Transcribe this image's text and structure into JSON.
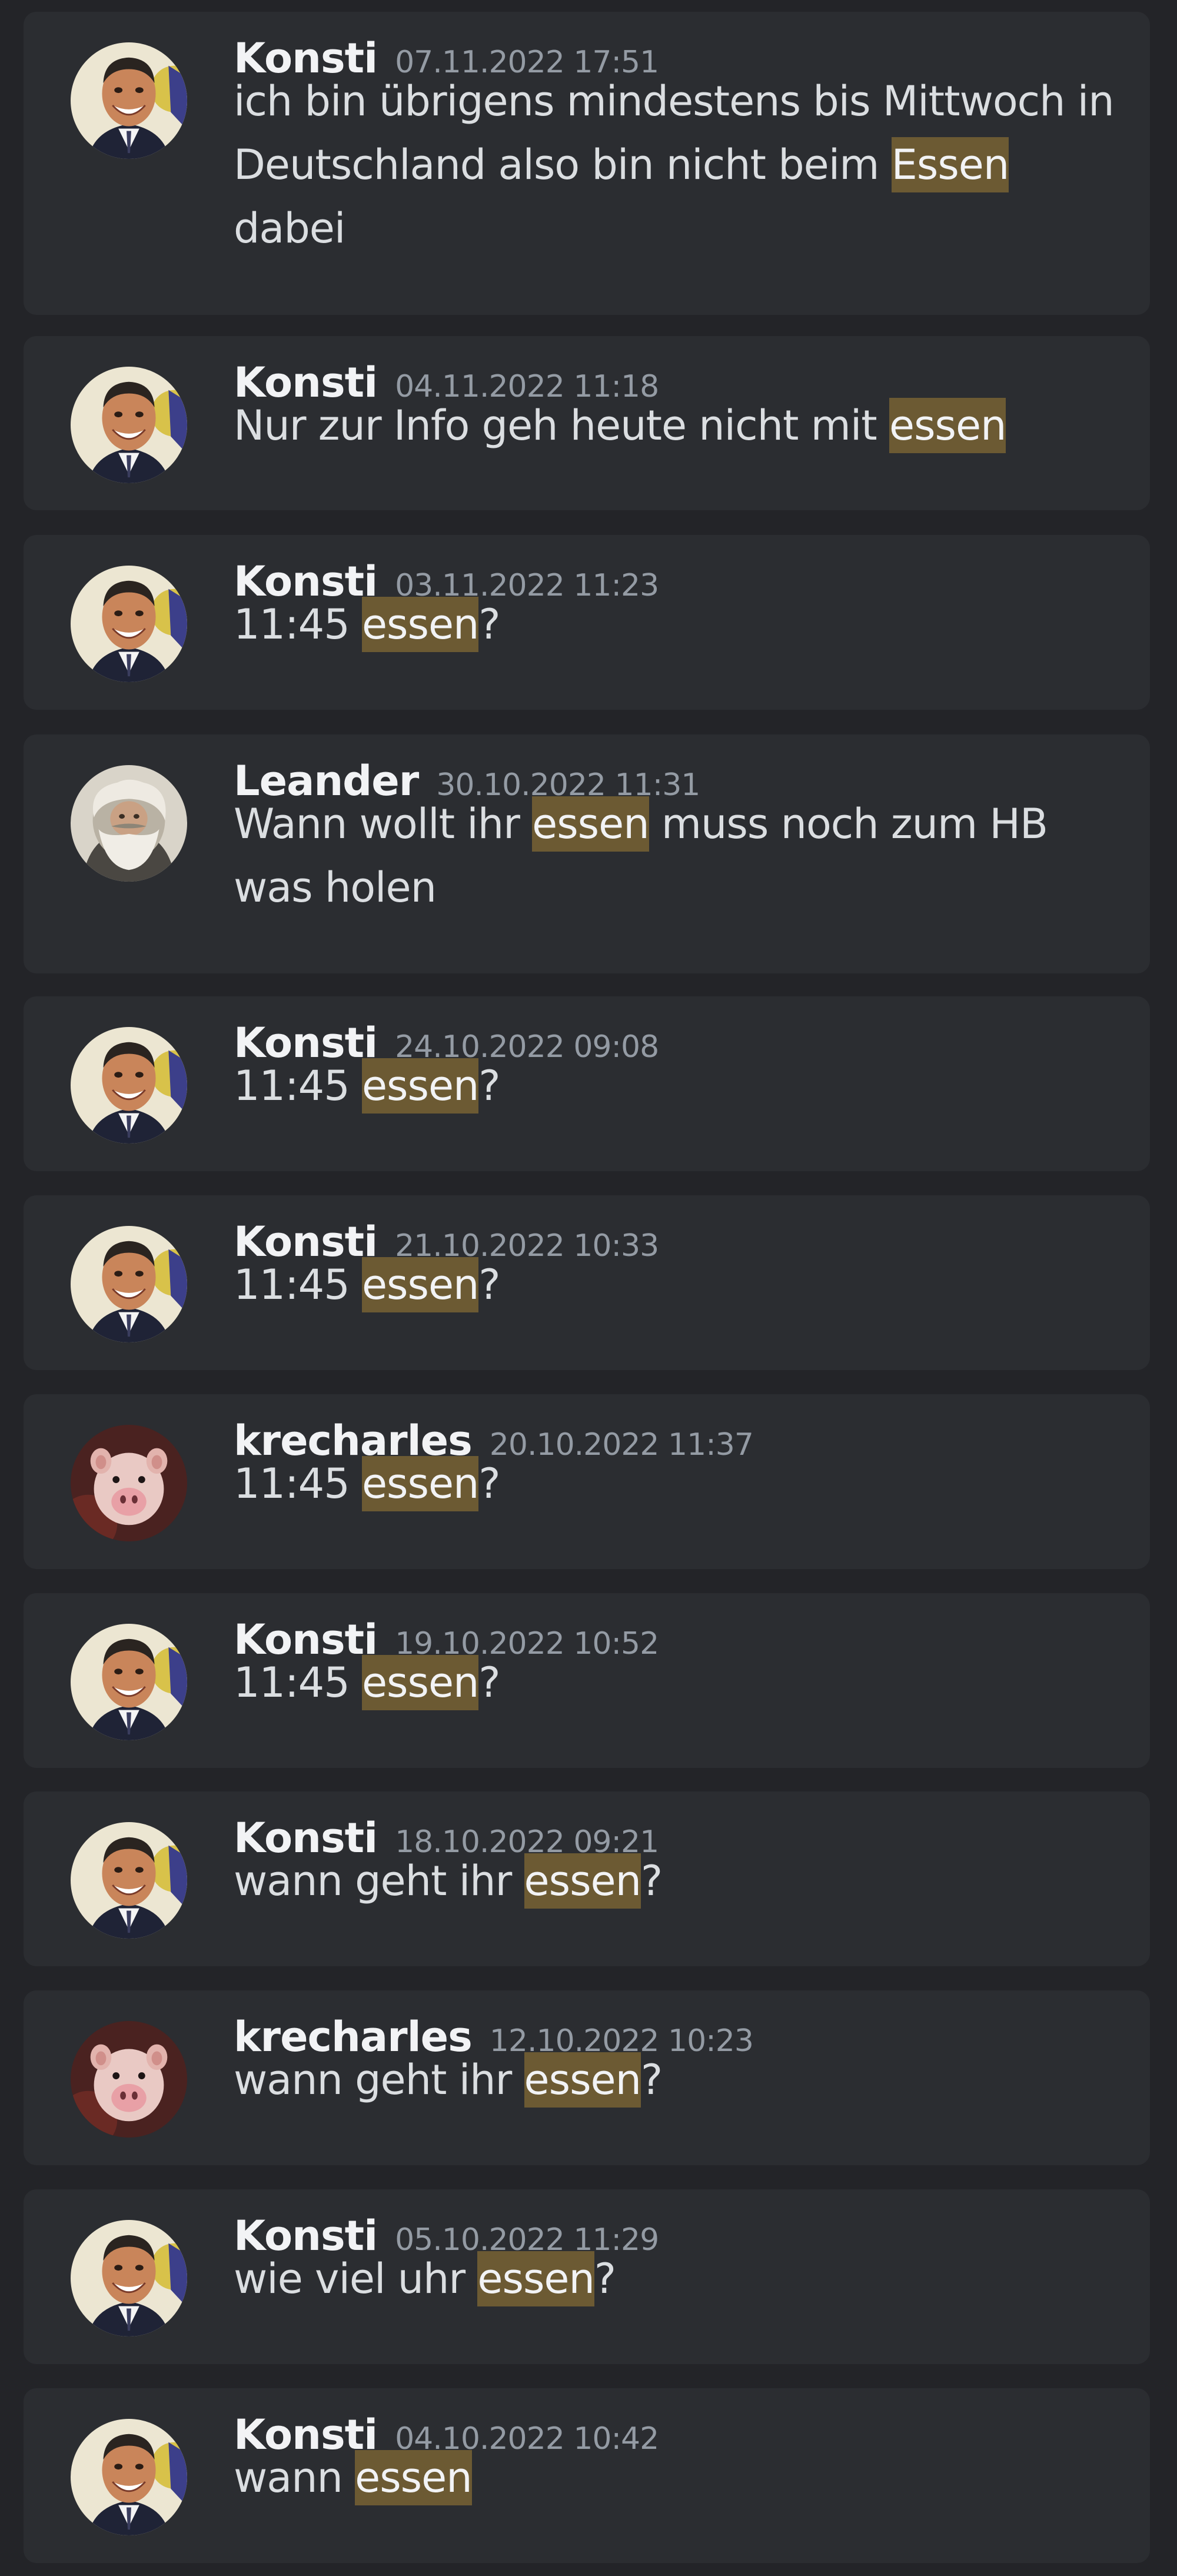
{
  "messages": [
    {
      "author": "Konsti",
      "timestamp": "07.11.2022 17:51",
      "avatar": "konsti",
      "segments": [
        {
          "text": "ich bin übrigens mindestens bis Mittwoch in Deutschland also bin nicht beim ",
          "highlight": false
        },
        {
          "text": "Essen",
          "highlight": true
        },
        {
          "text": " dabei",
          "highlight": false
        }
      ]
    },
    {
      "author": "Konsti",
      "timestamp": "04.11.2022 11:18",
      "avatar": "konsti",
      "segments": [
        {
          "text": "Nur zur Info geh heute nicht mit ",
          "highlight": false
        },
        {
          "text": "essen",
          "highlight": true
        }
      ]
    },
    {
      "author": "Konsti",
      "timestamp": "03.11.2022 11:23",
      "avatar": "konsti",
      "segments": [
        {
          "text": "11:45 ",
          "highlight": false
        },
        {
          "text": "essen",
          "highlight": true
        },
        {
          "text": "?",
          "highlight": false
        }
      ]
    },
    {
      "author": "Leander",
      "timestamp": "30.10.2022 11:31",
      "avatar": "leander",
      "segments": [
        {
          "text": "Wann wollt ihr ",
          "highlight": false
        },
        {
          "text": "essen",
          "highlight": true
        },
        {
          "text": " muss noch zum HB was holen",
          "highlight": false
        }
      ]
    },
    {
      "author": "Konsti",
      "timestamp": "24.10.2022 09:08",
      "avatar": "konsti",
      "segments": [
        {
          "text": "11:45 ",
          "highlight": false
        },
        {
          "text": "essen",
          "highlight": true
        },
        {
          "text": "?",
          "highlight": false
        }
      ]
    },
    {
      "author": "Konsti",
      "timestamp": "21.10.2022 10:33",
      "avatar": "konsti",
      "segments": [
        {
          "text": "11:45 ",
          "highlight": false
        },
        {
          "text": "essen",
          "highlight": true
        },
        {
          "text": "?",
          "highlight": false
        }
      ]
    },
    {
      "author": "krecharles",
      "timestamp": "20.10.2022 11:37",
      "avatar": "krecharles",
      "segments": [
        {
          "text": "11:45 ",
          "highlight": false
        },
        {
          "text": "essen",
          "highlight": true
        },
        {
          "text": "?",
          "highlight": false
        }
      ]
    },
    {
      "author": "Konsti",
      "timestamp": "19.10.2022 10:52",
      "avatar": "konsti",
      "segments": [
        {
          "text": "11:45 ",
          "highlight": false
        },
        {
          "text": "essen",
          "highlight": true
        },
        {
          "text": "?",
          "highlight": false
        }
      ]
    },
    {
      "author": "Konsti",
      "timestamp": "18.10.2022 09:21",
      "avatar": "konsti",
      "segments": [
        {
          "text": "wann geht ihr ",
          "highlight": false
        },
        {
          "text": "essen",
          "highlight": true
        },
        {
          "text": "?",
          "highlight": false
        }
      ]
    },
    {
      "author": "krecharles",
      "timestamp": "12.10.2022 10:23",
      "avatar": "krecharles",
      "segments": [
        {
          "text": "wann geht ihr ",
          "highlight": false
        },
        {
          "text": "essen",
          "highlight": true
        },
        {
          "text": "?",
          "highlight": false
        }
      ]
    },
    {
      "author": "Konsti",
      "timestamp": "05.10.2022 11:29",
      "avatar": "konsti",
      "segments": [
        {
          "text": "wie viel uhr ",
          "highlight": false
        },
        {
          "text": "essen",
          "highlight": true
        },
        {
          "text": "?",
          "highlight": false
        }
      ]
    },
    {
      "author": "Konsti",
      "timestamp": "04.10.2022 10:42",
      "avatar": "konsti",
      "segments": [
        {
          "text": "wann ",
          "highlight": false
        },
        {
          "text": "essen",
          "highlight": true
        }
      ]
    }
  ]
}
